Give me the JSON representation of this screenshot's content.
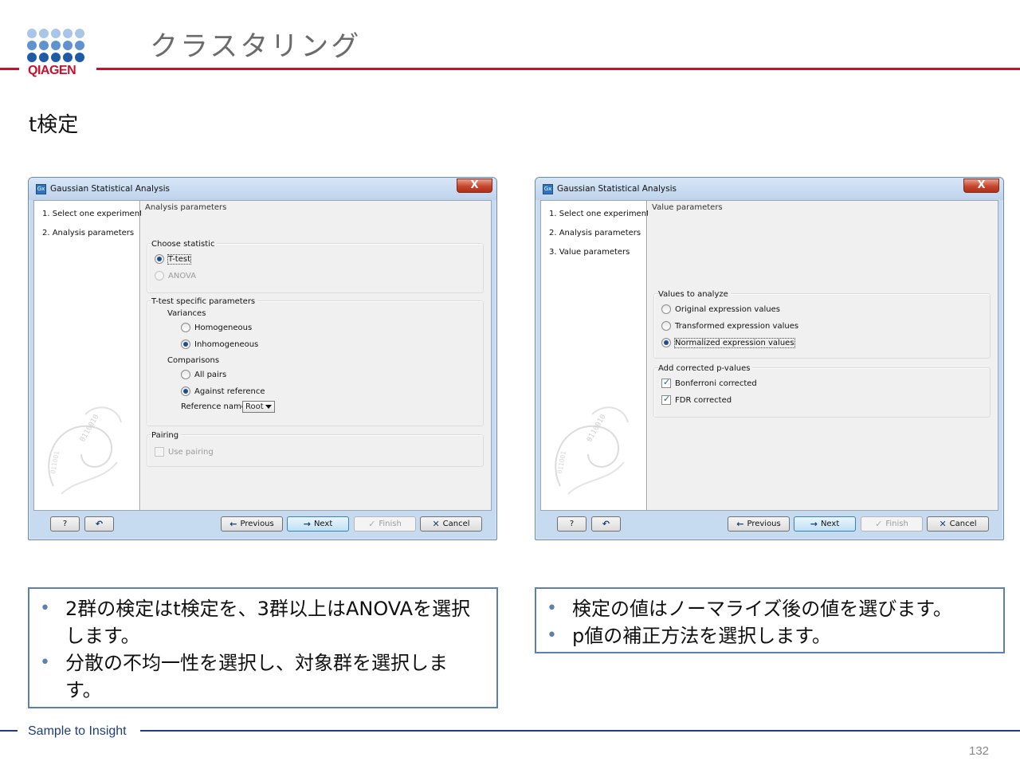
{
  "slide": {
    "title": "クラスタリング",
    "subtitle": "t検定",
    "logo_text": "QIAGEN",
    "footer_text": "Sample to Insight",
    "page_number": "132",
    "colors": {
      "brand_red": "#c8102e",
      "brand_blue": "#1f3d7a",
      "logo_dark": "#2a6bb5",
      "logo_light": "#a9c6e8"
    }
  },
  "dialog_left": {
    "app_icon": "Gx",
    "window_title": "Gaussian Statistical Analysis",
    "close_glyph": "X",
    "steps": [
      "1.  Select one experiment",
      "2.  Analysis parameters"
    ],
    "pane_header": "Analysis parameters",
    "choose_statistic": {
      "label": "Choose statistic",
      "options": [
        {
          "label": "T-test",
          "selected": true,
          "enabled": true
        },
        {
          "label": "ANOVA",
          "selected": false,
          "enabled": false
        }
      ]
    },
    "ttest_params": {
      "label": "T-test specific parameters",
      "variances_label": "Variances",
      "variances": [
        {
          "label": "Homogeneous",
          "selected": false
        },
        {
          "label": "Inhomogeneous",
          "selected": true
        }
      ],
      "comparisons_label": "Comparisons",
      "comparisons": [
        {
          "label": "All pairs",
          "selected": false
        },
        {
          "label": "Against reference",
          "selected": true
        }
      ],
      "reference_name_label": "Reference name",
      "reference_name_value": "Root"
    },
    "pairing": {
      "label": "Pairing",
      "use_pairing_label": "Use pairing",
      "use_pairing_checked": false,
      "use_pairing_enabled": false
    },
    "buttons": {
      "help": "?",
      "reset_icon": "reset-icon",
      "previous": "Previous",
      "next": "Next",
      "finish": "Finish",
      "cancel": "Cancel"
    }
  },
  "dialog_right": {
    "app_icon": "Gx",
    "window_title": "Gaussian Statistical Analysis",
    "close_glyph": "X",
    "steps": [
      "1.  Select one experiment",
      "2.  Analysis parameters",
      "3.  Value parameters"
    ],
    "pane_header": "Value parameters",
    "values_to_analyze": {
      "label": "Values to analyze",
      "options": [
        {
          "label": "Original expression values",
          "selected": false
        },
        {
          "label": "Transformed expression values",
          "selected": false
        },
        {
          "label": "Normalized expression values",
          "selected": true
        }
      ]
    },
    "corrected_pvalues": {
      "label": "Add corrected p-values",
      "options": [
        {
          "label": "Bonferroni corrected",
          "checked": true
        },
        {
          "label": "FDR corrected",
          "checked": true
        }
      ]
    },
    "buttons": {
      "help": "?",
      "reset_icon": "reset-icon",
      "previous": "Previous",
      "next": "Next",
      "finish": "Finish",
      "cancel": "Cancel"
    }
  },
  "bullets_left": [
    "2群の検定はt検定を、3群以上はANOVAを選択します。",
    "分散の不均一性を選択し、対象群を選択します。"
  ],
  "bullets_right": [
    "検定の値はノーマライズ後の値を選びます。",
    "p値の補正方法を選択します。"
  ]
}
